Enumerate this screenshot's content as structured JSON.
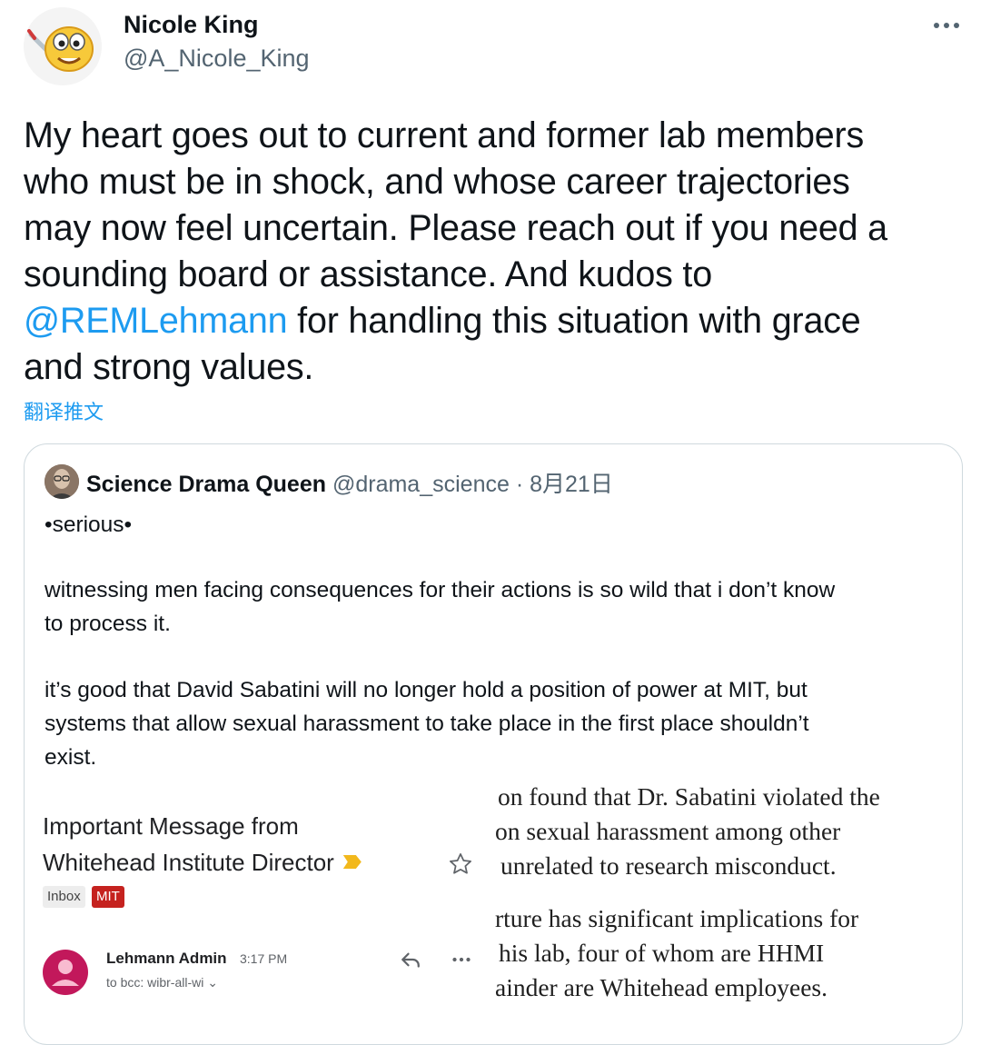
{
  "tweet": {
    "author_name": "Nicole King",
    "author_handle": "@A_Nicole_King",
    "text_lines": [
      "My heart goes out to current and former lab members",
      "who must be in shock, and whose career trajectories",
      "may now feel uncertain. Please reach out if you need a",
      "sounding board or assistance. And kudos to"
    ],
    "mention": "@REMLehmann",
    "mention_line_rest": " for handling this situation with grace",
    "last_line": "and strong values.",
    "translate_label": "翻译推文",
    "icons": {
      "more": "more-horizontal-icon"
    }
  },
  "quote": {
    "author_name": "Science Drama Queen",
    "author_handle": "@drama_science",
    "separator": " · ",
    "date": "8月21日",
    "body_lines": [
      "•serious•",
      "",
      "witnessing men facing consequences for their actions is so wild that i don’t know",
      "to process it.",
      "",
      "it’s good that David Sabatini will no longer hold a position of power at MIT, but",
      "systems that allow sexual harassment to take place in the first place shouldn’t",
      "exist."
    ],
    "screenshot": {
      "subject_line_1": "Important Message from",
      "subject_line_2": "Whitehead Institute Director",
      "label_inbox": "Inbox",
      "label_mit": "MIT",
      "sender_name": "Lehmann Admin",
      "sender_time": "3:17 PM",
      "to_line": "to bcc: wibr-all-wi",
      "doc_lines": [
        "on found that Dr. Sabatini violated the",
        "on sexual harassment among other",
        "unrelated to research misconduct.",
        "rture has significant implications for",
        "his lab, four of whom are HHMI",
        "ainder are Whitehead employees."
      ],
      "colors": {
        "mit_label": "#c5221f",
        "sender_avatar": "#c2185b",
        "importance": "#f2b81c"
      }
    }
  },
  "colors": {
    "link": "#1d9bf0",
    "secondary_text": "#536471",
    "border": "#cfd9de"
  }
}
